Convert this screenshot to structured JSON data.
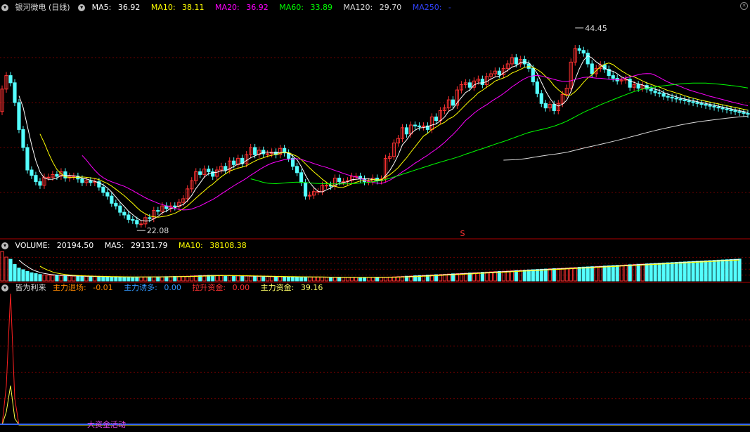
{
  "stock": {
    "title": "银河微电 (日线)"
  },
  "price_header": {
    "ma5": {
      "label": "MA5:",
      "value": "36.92",
      "color": "#ffffff"
    },
    "ma10": {
      "label": "MA10:",
      "value": "38.11",
      "color": "#ffff00"
    },
    "ma20": {
      "label": "MA20:",
      "value": "36.92",
      "color": "#ff00ff"
    },
    "ma60": {
      "label": "MA60:",
      "value": "33.89",
      "color": "#00ff00"
    },
    "ma120": {
      "label": "MA120:",
      "value": "29.70",
      "color": "#dddddd"
    },
    "ma250": {
      "label": "MA250:",
      "value": "-",
      "color": "#3344ff"
    }
  },
  "volume_header": {
    "volume": {
      "label": "VOLUME:",
      "value": "20194.50"
    },
    "ma5": {
      "label": "MA5:",
      "value": "29131.79"
    },
    "ma10": {
      "label": "MA10:",
      "value": "38108.38"
    }
  },
  "indicator_header": {
    "name": "皆为利来",
    "items": [
      {
        "label": "主力退场:",
        "value": "-0.01",
        "color": "#ff8800"
      },
      {
        "label": "主力诱多:",
        "value": "0.00",
        "color": "#3399ff"
      },
      {
        "label": "拉升资金:",
        "value": "0.00",
        "color": "#ff3333"
      },
      {
        "label": "主力资金:",
        "value": "39.16",
        "color": "#ffff66"
      }
    ]
  },
  "annotations": {
    "high": "44.45",
    "low": "22.08",
    "marker": "S",
    "activity": "大资金活动"
  },
  "colors": {
    "up": "#ff3232",
    "down": "#54ffff",
    "grid": "#6e0000",
    "separator": "#b00000",
    "ma5": "#ffffff",
    "ma10": "#ffff00",
    "ma20": "#ff00ff",
    "ma60": "#00ff00",
    "ma120": "#dddddd"
  },
  "chart_data": {
    "type": "candlestick",
    "x": [
      1,
      2,
      3,
      4,
      5,
      6,
      7,
      8,
      9,
      10,
      11,
      12,
      13,
      14,
      15,
      16,
      17,
      18,
      19,
      20,
      21,
      22,
      23,
      24,
      25,
      26,
      27,
      28,
      29,
      30,
      31,
      32,
      33,
      34,
      35,
      36,
      37,
      38,
      39,
      40,
      41,
      42,
      43,
      44,
      45,
      46,
      47,
      48,
      49,
      50,
      51,
      52,
      53,
      54,
      55,
      56,
      57,
      58,
      59,
      60,
      61,
      62,
      63,
      64,
      65,
      66,
      67,
      68,
      69,
      70,
      71,
      72,
      73,
      74,
      75,
      76,
      77,
      78,
      79,
      80,
      81,
      82,
      83,
      84,
      85,
      86,
      87,
      88,
      89,
      90,
      91,
      92,
      93,
      94,
      95,
      96,
      97,
      98,
      99,
      100,
      101,
      102,
      103,
      104,
      105,
      106,
      107,
      108,
      109,
      110,
      111,
      112,
      113,
      114,
      115,
      116,
      117,
      118,
      119,
      120,
      121,
      122,
      123,
      124,
      125,
      126,
      127,
      128,
      129,
      130,
      131,
      132,
      133,
      134,
      135,
      136,
      137,
      138,
      139,
      140,
      141,
      142,
      143,
      144,
      145,
      146,
      147,
      148,
      149,
      150,
      151,
      152,
      153,
      154,
      155,
      156,
      157,
      158,
      159,
      160,
      161,
      162,
      163,
      164,
      165,
      166,
      167,
      168,
      169,
      170,
      171,
      172,
      173,
      174,
      175,
      176,
      177,
      178,
      179,
      180
    ],
    "open": [
      35.0,
      37.5,
      39.0,
      38.2,
      36.0,
      33.0,
      31.0,
      28.5,
      27.9,
      27.2,
      26.8,
      27.7,
      27.7,
      28.0,
      27.8,
      28.3,
      27.6,
      27.8,
      27.8,
      27.5,
      27.1,
      27.3,
      27.1,
      27.2,
      26.6,
      26.0,
      25.6,
      24.8,
      24.5,
      23.8,
      23.5,
      23.0,
      22.9,
      22.5,
      22.5,
      23.2,
      23.1,
      24.0,
      23.9,
      24.5,
      24.2,
      24.5,
      24.4,
      24.9,
      25.3,
      26.4,
      27.3,
      28.3,
      28.0,
      28.6,
      28.3,
      27.8,
      28.5,
      28.9,
      28.5,
      29.5,
      29.1,
      29.8,
      29.2,
      30.2,
      31.0,
      30.2,
      30.7,
      30.3,
      30.3,
      30.5,
      30.2,
      30.9,
      30.4,
      29.8,
      28.9,
      28.2,
      27.1,
      25.6,
      25.7,
      26.1,
      26.1,
      26.8,
      26.8,
      26.7,
      27.6,
      27.2,
      27.2,
      27.3,
      27.8,
      27.8,
      27.5,
      27.2,
      27.2,
      27.6,
      27.3,
      27.5,
      29.8,
      30.0,
      31.5,
      32.0,
      33.2,
      32.5,
      33.5,
      33.4,
      33.3,
      33.4,
      33.0,
      34.4,
      34.0,
      35.1,
      35.4,
      36.3,
      35.7,
      37.4,
      38.0,
      38.2,
      37.7,
      38.4,
      38.6,
      38.0,
      38.9,
      39.2,
      39.5,
      39.1,
      39.8,
      40.3,
      41.0,
      40.3,
      40.8,
      40.3,
      39.8,
      38.3,
      37.0,
      35.9,
      35.4,
      35.8,
      35.1,
      35.9,
      36.9,
      37.6,
      40.5,
      42.0,
      41.8,
      41.5,
      40.3,
      39.2,
      39.8,
      40.2,
      39.7,
      39.0,
      38.7,
      38.4,
      38.5,
      38.6,
      37.7,
      38.0,
      37.6,
      37.9,
      37.5,
      37.3,
      37.1,
      37.0,
      36.7,
      36.6,
      36.5,
      36.4,
      36.3,
      36.2,
      36.1,
      36.0,
      35.9,
      35.8,
      35.7,
      35.6,
      35.5,
      35.4,
      35.3,
      35.2,
      35.1,
      35.0,
      34.9,
      34.8
    ],
    "close": [
      37.5,
      39.0,
      38.2,
      36.0,
      33.0,
      31.0,
      28.5,
      27.9,
      27.2,
      26.8,
      27.7,
      27.7,
      28.0,
      27.8,
      28.3,
      27.6,
      27.8,
      27.8,
      27.5,
      27.1,
      27.3,
      27.1,
      27.2,
      26.6,
      26.0,
      25.6,
      24.8,
      24.5,
      23.8,
      23.5,
      23.0,
      22.9,
      22.5,
      22.5,
      23.2,
      23.1,
      24.0,
      23.9,
      24.5,
      24.2,
      24.5,
      24.4,
      24.9,
      25.3,
      26.4,
      27.3,
      28.3,
      28.0,
      28.6,
      28.3,
      27.8,
      28.5,
      28.9,
      28.5,
      29.5,
      29.1,
      29.8,
      29.2,
      30.2,
      31.0,
      30.2,
      30.7,
      30.3,
      30.3,
      30.5,
      30.2,
      30.9,
      30.4,
      29.8,
      28.9,
      28.2,
      27.1,
      25.6,
      25.7,
      26.1,
      26.1,
      26.8,
      26.8,
      26.7,
      27.6,
      27.2,
      27.2,
      27.3,
      27.8,
      27.8,
      27.5,
      27.2,
      27.2,
      27.6,
      27.3,
      27.5,
      29.8,
      30.0,
      31.5,
      32.0,
      33.2,
      32.5,
      33.5,
      33.4,
      33.3,
      33.4,
      33.0,
      34.4,
      34.0,
      35.1,
      35.4,
      36.3,
      35.7,
      37.4,
      38.0,
      38.2,
      37.7,
      38.4,
      38.6,
      38.0,
      38.9,
      39.2,
      39.5,
      39.1,
      39.8,
      40.3,
      41.0,
      40.3,
      40.8,
      40.3,
      39.8,
      38.3,
      37.0,
      35.9,
      35.4,
      35.8,
      35.1,
      35.9,
      36.9,
      37.6,
      40.5,
      42.0,
      41.8,
      41.5,
      40.3,
      39.2,
      39.8,
      40.2,
      39.7,
      39.0,
      38.7,
      38.4,
      38.5,
      38.6,
      37.7,
      38.0,
      37.6,
      37.9,
      37.5,
      37.3,
      37.1,
      37.0,
      36.7,
      36.6,
      36.5,
      36.4,
      36.3,
      36.2,
      36.1,
      36.0,
      35.9,
      35.8,
      35.7,
      35.6,
      35.5,
      35.4,
      35.3,
      35.2,
      35.1,
      35.0,
      34.9,
      34.8,
      34.7
    ],
    "high": 44.45,
    "low": 22.08,
    "ylim": [
      21.0,
      46.0
    ],
    "volume": [
      68000,
      55000,
      50000,
      38000,
      30000,
      26000,
      22000,
      19000,
      17000,
      15000,
      14000,
      13500,
      13000,
      12500,
      12000,
      11800,
      11500,
      11200,
      11000,
      10800,
      10500,
      10300,
      10100,
      9900,
      9700,
      9500,
      9400,
      9300,
      9200,
      9100,
      9000,
      9000,
      9100,
      9200,
      9300,
      9400,
      9500,
      9600,
      9800,
      10000,
      10200,
      10400,
      10600,
      10800,
      11000,
      11500,
      12000,
      12500,
      12800,
      13000,
      12800,
      12600,
      12400,
      12200,
      12000,
      11800,
      11600,
      11400,
      11200,
      11000,
      10800,
      10600,
      10400,
      10200,
      10000,
      9800,
      9700,
      9600,
      9500,
      9400,
      9300,
      9200,
      9100,
      9000,
      8900,
      8800,
      8700,
      8600,
      8500,
      8400,
      8300,
      8200,
      8100,
      8000,
      8100,
      8200,
      8300,
      8400,
      8500,
      8600,
      8700,
      8800,
      9000,
      9500,
      10000,
      10500,
      11000,
      11500,
      12000,
      12500,
      13000,
      13500,
      14000,
      14500,
      15000,
      15500,
      16000,
      16500,
      17000,
      17500,
      18000,
      18500,
      19000,
      19500,
      20000,
      20500,
      21000,
      21500,
      22000,
      22500,
      23000,
      23500,
      24000,
      24500,
      25000,
      25500,
      26000,
      26500,
      27000,
      27500,
      28000,
      28500,
      29000,
      29500,
      30000,
      30500,
      31000,
      31500,
      32000,
      32500,
      33000,
      33500,
      34000,
      34500,
      35000,
      35500,
      36000,
      36500,
      37000,
      37500,
      38000,
      38500,
      39000,
      39500,
      40000,
      40500,
      41000,
      41500,
      42000,
      42500,
      43000,
      43500,
      44000,
      44500,
      45000,
      45500,
      46000,
      46500,
      47000,
      47500,
      48000,
      48500,
      49000,
      49500,
      50000,
      50500
    ],
    "indicator": {
      "red": [
        0,
        30,
        100,
        20,
        0,
        0,
        0,
        0,
        0,
        0,
        0,
        0,
        0,
        0,
        0,
        0,
        0,
        0,
        0,
        0,
        0,
        0,
        0,
        0,
        0,
        0,
        0,
        0,
        0,
        0,
        0,
        0,
        0,
        0,
        0,
        0,
        0,
        0,
        0,
        0,
        0,
        0,
        0,
        0,
        0,
        0,
        0,
        0,
        0,
        0,
        0,
        0,
        0,
        0,
        0,
        0,
        0,
        0,
        0,
        0,
        0,
        0,
        0,
        0,
        0,
        0,
        0,
        0,
        0,
        0,
        0,
        0,
        0,
        0,
        0,
        0,
        0,
        0,
        0,
        0,
        0,
        0,
        0,
        0,
        0,
        0,
        0,
        0,
        0,
        0,
        0,
        0,
        0,
        0,
        0,
        0,
        0,
        0,
        0,
        0,
        0,
        0,
        0,
        0,
        0,
        0,
        0,
        0,
        0,
        0,
        0,
        0,
        0,
        0,
        0,
        0,
        0,
        0,
        0,
        0,
        0,
        0,
        0,
        0,
        0,
        0,
        0,
        0,
        0,
        0,
        0,
        0,
        0,
        0,
        0,
        0,
        0,
        0,
        0,
        0,
        0,
        0,
        0,
        0,
        0,
        0,
        0,
        0,
        0,
        0,
        0,
        0,
        0,
        0,
        0,
        0,
        0,
        0,
        0,
        0,
        0,
        0,
        0,
        0,
        0,
        0,
        0,
        0,
        0,
        0,
        0,
        0,
        0,
        0,
        0,
        0,
        0,
        0,
        0,
        0
      ],
      "yellow": [
        0,
        10,
        30,
        5,
        0,
        0,
        0,
        0,
        0,
        0,
        0,
        0,
        0,
        0,
        0,
        0,
        0,
        0,
        0,
        0,
        0,
        0,
        0,
        0,
        0,
        0,
        0,
        0,
        0,
        0,
        0,
        0,
        0,
        0,
        0,
        0,
        0,
        0,
        0,
        0,
        0,
        0,
        0,
        0,
        0,
        0,
        0,
        0,
        0,
        0,
        0,
        0,
        0,
        0,
        0,
        0,
        0,
        0,
        0,
        0,
        0,
        0,
        0,
        0,
        0,
        0,
        0,
        0,
        0,
        0,
        0,
        0,
        0,
        0,
        0,
        0,
        0,
        0,
        0,
        0,
        0,
        0,
        0,
        0,
        0,
        0,
        0,
        0,
        0,
        0,
        0,
        0,
        0,
        0,
        0,
        0,
        0,
        0,
        0,
        0,
        0,
        0,
        0,
        0,
        0,
        0,
        0,
        0,
        0,
        0,
        0,
        0,
        0,
        0,
        0,
        0,
        0,
        0,
        0,
        0,
        0,
        0,
        0,
        0,
        0,
        0,
        0,
        0,
        0,
        0,
        0,
        0,
        0,
        0,
        0,
        0,
        0,
        0,
        0,
        0,
        0,
        0,
        0,
        0,
        0,
        0,
        0,
        0,
        0,
        0,
        0,
        0,
        0,
        0,
        0,
        0,
        0,
        0,
        0,
        0,
        0,
        0,
        0,
        0,
        0,
        0,
        0,
        0,
        0,
        0,
        0,
        0,
        0,
        0,
        0,
        0,
        0,
        0,
        0,
        0
      ]
    }
  }
}
